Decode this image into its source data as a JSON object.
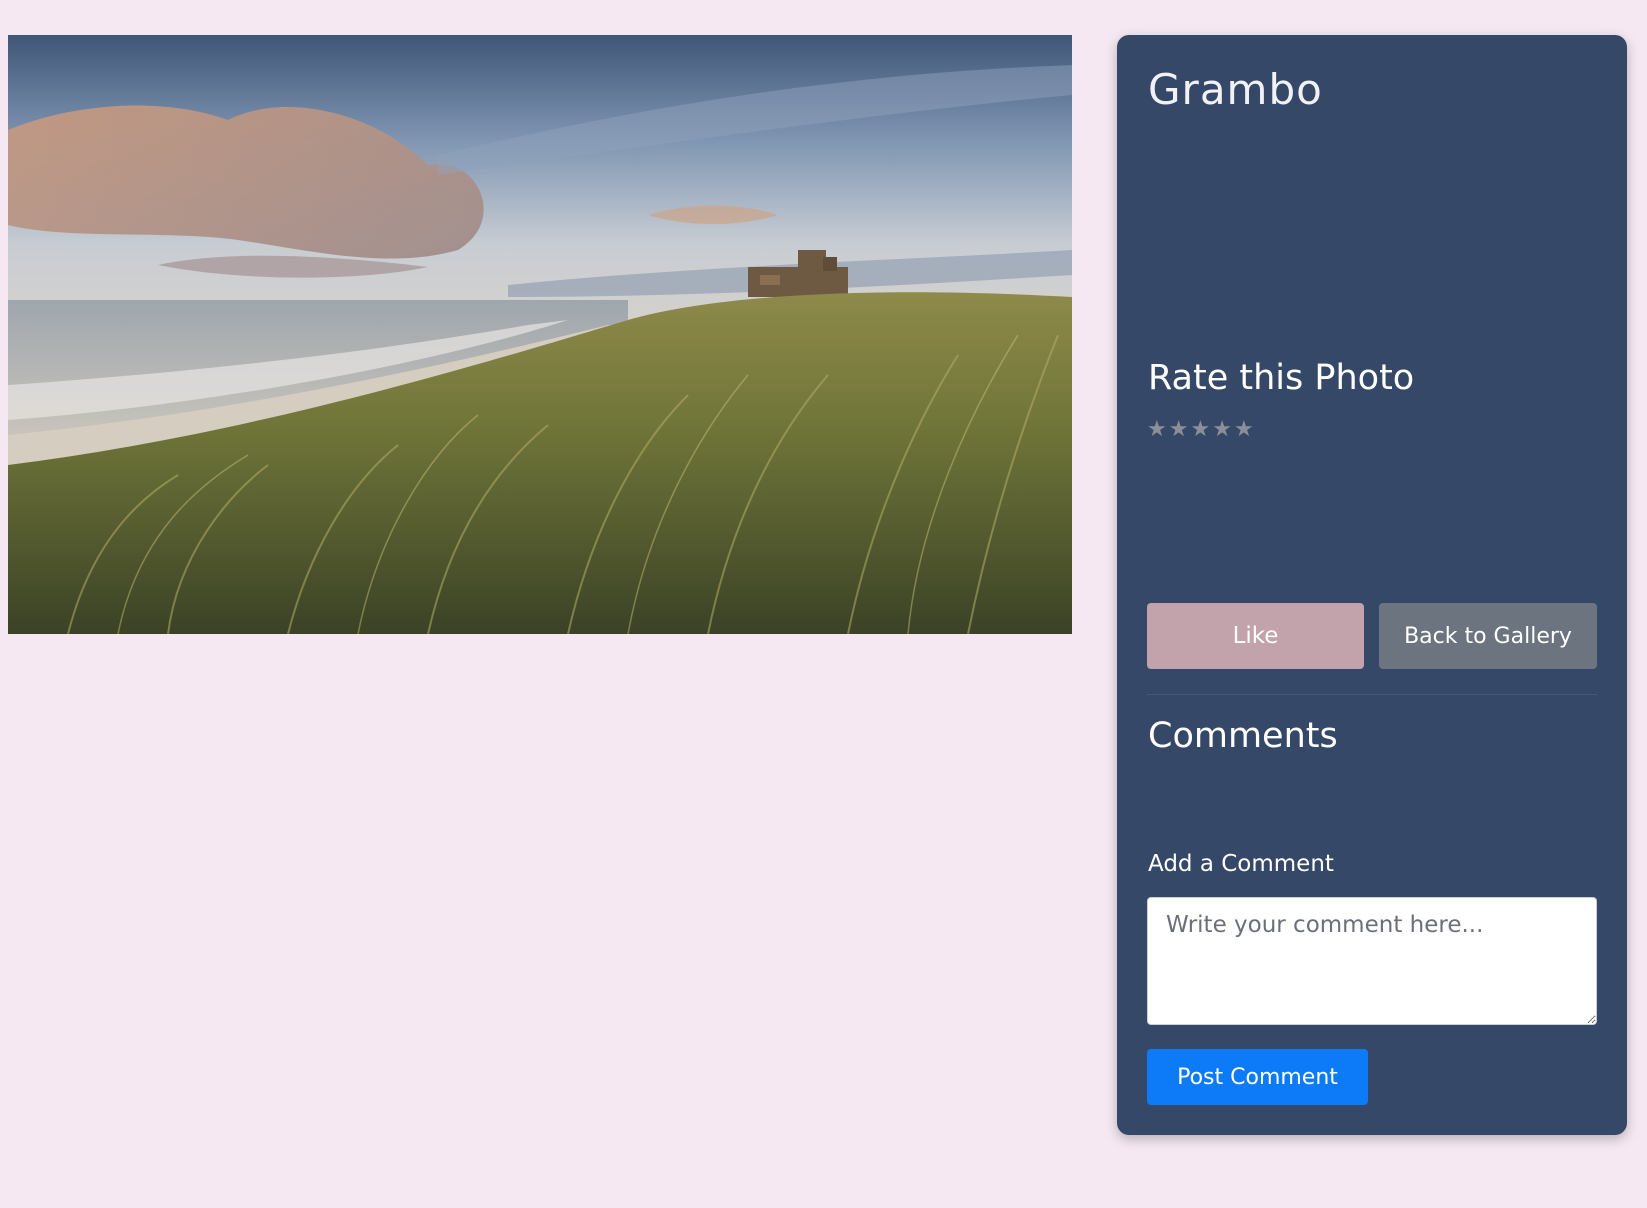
{
  "photo": {
    "title": "Grambo"
  },
  "rating": {
    "heading": "Rate this Photo",
    "stars": [
      "★",
      "★",
      "★",
      "★",
      "★"
    ],
    "current_value": 0,
    "max": 5
  },
  "actions": {
    "like_label": "Like",
    "back_label": "Back to Gallery"
  },
  "comments": {
    "heading": "Comments",
    "items": [],
    "add_label": "Add a Comment",
    "placeholder": "Write your comment here...",
    "value": "",
    "post_label": "Post Comment"
  },
  "colors": {
    "page_background": "#f5e8f2",
    "panel_background": "#364868",
    "like_button": "#c2a2ab",
    "back_button": "#6b747f",
    "post_button": "#0d7bf7"
  }
}
